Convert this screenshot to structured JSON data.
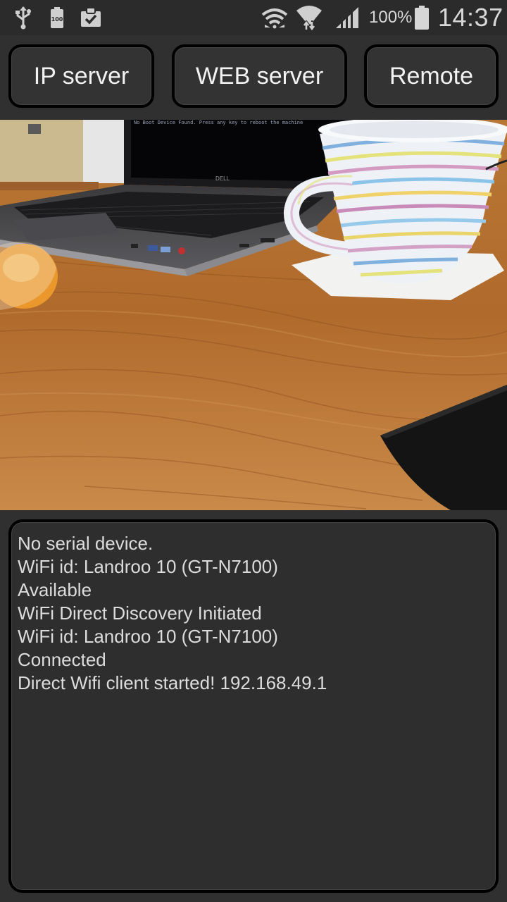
{
  "status_bar": {
    "icons": [
      "usb-icon",
      "battery-100-icon",
      "clipboard-check-icon",
      "wifi-direct-icon",
      "wifi-icon",
      "cell-signal-icon",
      "battery-icon"
    ],
    "battery_small_label": "100",
    "battery_percent": "100%",
    "time": "14:37"
  },
  "toolbar": {
    "ip_server_label": "IP server",
    "web_server_label": "WEB server",
    "remote_label": "Remote"
  },
  "camera_preview": {
    "laptop_brand": "DELL",
    "laptop_screen_text": "No Boot Device Found. Press any key to reboot the machine"
  },
  "log": {
    "lines": [
      "No serial device.",
      "WiFi id: Landroo 10 (GT-N7100)",
      "Available",
      "WiFi Direct Discovery Initiated",
      "WiFi id: Landroo 10 (GT-N7100)",
      "Connected",
      "Direct Wifi client started! 192.168.49.1"
    ]
  },
  "colors": {
    "background": "#303030",
    "status_bar": "#2b2b2b",
    "button_border": "#000000",
    "text": "#dcdcdc"
  }
}
